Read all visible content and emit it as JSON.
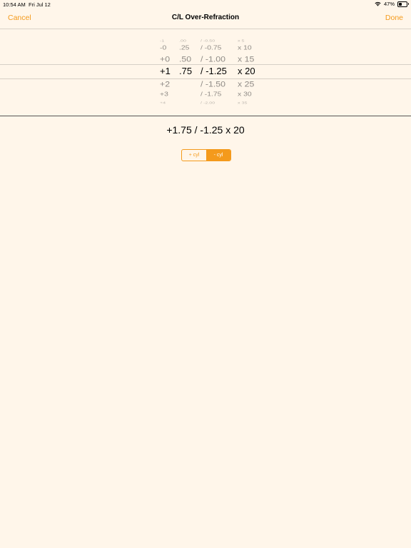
{
  "status": {
    "time": "10:54 AM",
    "date": "Fri Jul 12",
    "battery": "47%",
    "battery_level": 0.47,
    "icons": [
      "wifi-icon",
      "battery-icon"
    ]
  },
  "nav": {
    "cancel": "Cancel",
    "title": "C/L Over-Refraction",
    "done": "Done"
  },
  "picker": {
    "col_diopter": [
      "-1",
      "-0",
      "+0",
      "+1",
      "+2",
      "+3",
      "+4"
    ],
    "col_fraction": [
      ".00",
      ".25",
      ".50",
      ".75"
    ],
    "col_cylinder": [
      "/ -0.50",
      "/ -0.75",
      "/ -1.00",
      "/ -1.25",
      "/ -1.50",
      "/ -1.75",
      "/ -2.00"
    ],
    "col_axis": [
      "x 5",
      "x 10",
      "x 15",
      "x 20",
      "x 25",
      "x 30",
      "x 35"
    ]
  },
  "result": "+1.75 / -1.25 x 20",
  "segment": {
    "plus": "+ cyl",
    "minus": "- cyl",
    "selected": "minus"
  },
  "colors": {
    "accent": "#f49a1c",
    "background": "#fff6ea"
  }
}
